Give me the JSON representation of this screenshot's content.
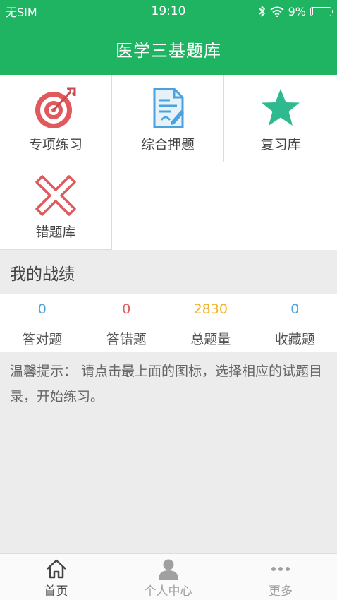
{
  "status": {
    "carrier": "无SIM",
    "time": "19:10",
    "battery": "9%",
    "battery_level": 0.09
  },
  "header": {
    "title": "医学三基题库"
  },
  "tiles": [
    {
      "label": "专项练习",
      "icon": "target-icon"
    },
    {
      "label": "综合押题",
      "icon": "document-pen-icon"
    },
    {
      "label": "复习库",
      "icon": "star-icon"
    },
    {
      "label": "错题库",
      "icon": "cross-icon"
    }
  ],
  "section": {
    "title": "我的战绩"
  },
  "stats": [
    {
      "value": "0",
      "label": "答对题",
      "color": "#4aa3df"
    },
    {
      "value": "0",
      "label": "答错题",
      "color": "#e0595e"
    },
    {
      "value": "2830",
      "label": "总题量",
      "color": "#f0b429"
    },
    {
      "value": "0",
      "label": "收藏题",
      "color": "#4aa3df"
    }
  ],
  "tip": {
    "text": "温馨提示： 请点击最上面的图标，选择相应的试题目录，开始练习。"
  },
  "nav": [
    {
      "label": "首页",
      "icon": "home-icon",
      "active": true
    },
    {
      "label": "个人中心",
      "icon": "user-icon",
      "active": false
    },
    {
      "label": "更多",
      "icon": "more-icon",
      "active": false
    }
  ],
  "colors": {
    "primary": "#1fb461",
    "nav_active": "#444444",
    "nav_inactive": "#a0a0a0"
  }
}
